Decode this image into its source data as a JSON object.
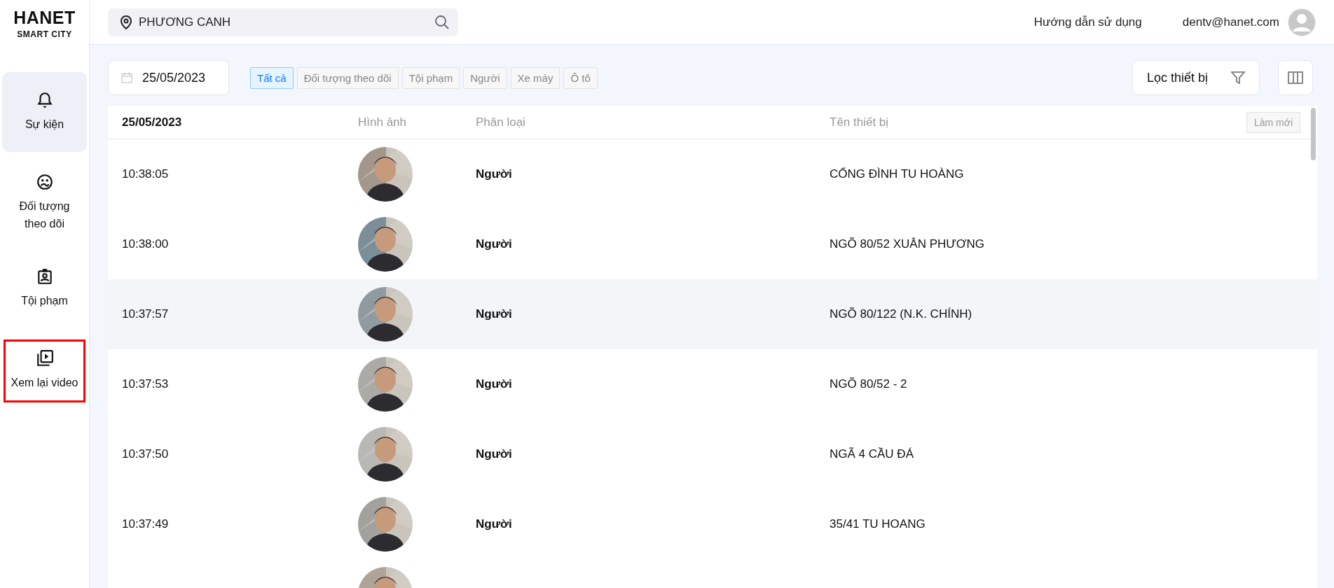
{
  "logo": {
    "brand": "HANET",
    "tagline": "SMART CITY"
  },
  "sidebar": {
    "items": [
      {
        "label": "Sự kiện",
        "selected": true,
        "highlighted": false
      },
      {
        "label": "Đối tượng theo dõi",
        "selected": false,
        "highlighted": false
      },
      {
        "label": "Tội phạm",
        "selected": false,
        "highlighted": false
      },
      {
        "label": "Xem lại video",
        "selected": false,
        "highlighted": true
      }
    ]
  },
  "header": {
    "search": {
      "value": "PHƯƠNG CANH"
    },
    "help_link": "Hướng dẫn sử dụng",
    "user_email": "dentv@hanet.com"
  },
  "toolbar": {
    "date": "25/05/2023",
    "filters": [
      {
        "label": "Tất cả",
        "selected": true
      },
      {
        "label": "Đối tượng theo dõi",
        "selected": false
      },
      {
        "label": "Tội phạm",
        "selected": false
      },
      {
        "label": "Người",
        "selected": false
      },
      {
        "label": "Xe máy",
        "selected": false
      },
      {
        "label": "Ô tô",
        "selected": false
      }
    ],
    "device_filter": "Lọc thiết bị"
  },
  "table": {
    "columns": [
      "25/05/2023",
      "Hình ảnh",
      "Phân loại",
      "Tên thiết bị"
    ],
    "refresh_button": "Làm mới",
    "rows": [
      {
        "time": "10:38:05",
        "category": "Người",
        "device": "CỔNG ĐÌNH TU HOÀNG",
        "selected": false
      },
      {
        "time": "10:38:00",
        "category": "Người",
        "device": "NGÕ 80/52 XUÂN PHƯƠNG",
        "selected": false
      },
      {
        "time": "10:37:57",
        "category": "Người",
        "device": "NGÕ 80/122 (N.K. CHÍNH)",
        "selected": true
      },
      {
        "time": "10:37:53",
        "category": "Người",
        "device": "NGÕ 80/52 - 2",
        "selected": false
      },
      {
        "time": "10:37:50",
        "category": "Người",
        "device": "NGÃ 4 CẦU ĐÁ",
        "selected": false
      },
      {
        "time": "10:37:49",
        "category": "Người",
        "device": "35/41 TU HOANG",
        "selected": false
      },
      {
        "selected": false
      }
    ]
  }
}
